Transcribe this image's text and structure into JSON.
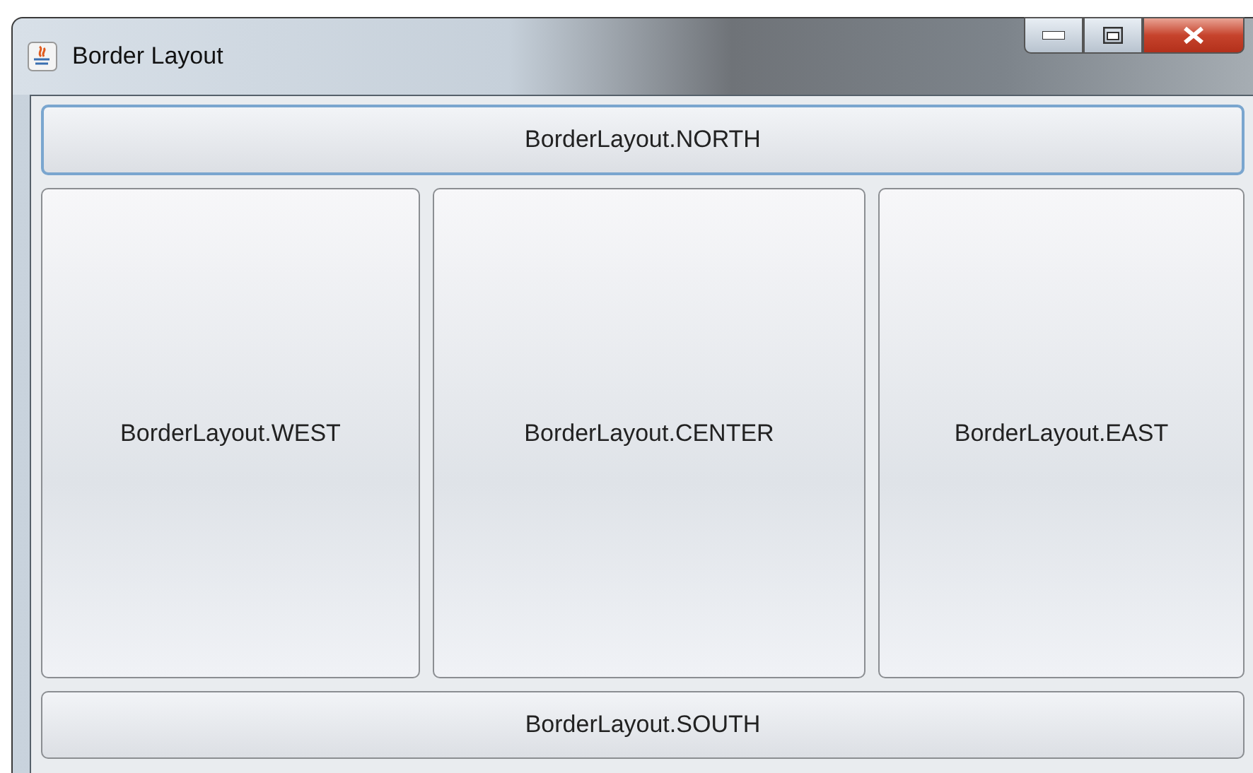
{
  "window": {
    "title": "Border Layout"
  },
  "north": {
    "label": "BorderLayout.NORTH",
    "focused": true
  },
  "middle": [
    {
      "label": "BorderLayout.WEST",
      "focused": false
    },
    {
      "label": "BorderLayout.CENTER",
      "focused": false
    },
    {
      "label": "BorderLayout.EAST",
      "focused": false
    }
  ],
  "south": {
    "label": "BorderLayout.SOUTH",
    "focused": false
  }
}
